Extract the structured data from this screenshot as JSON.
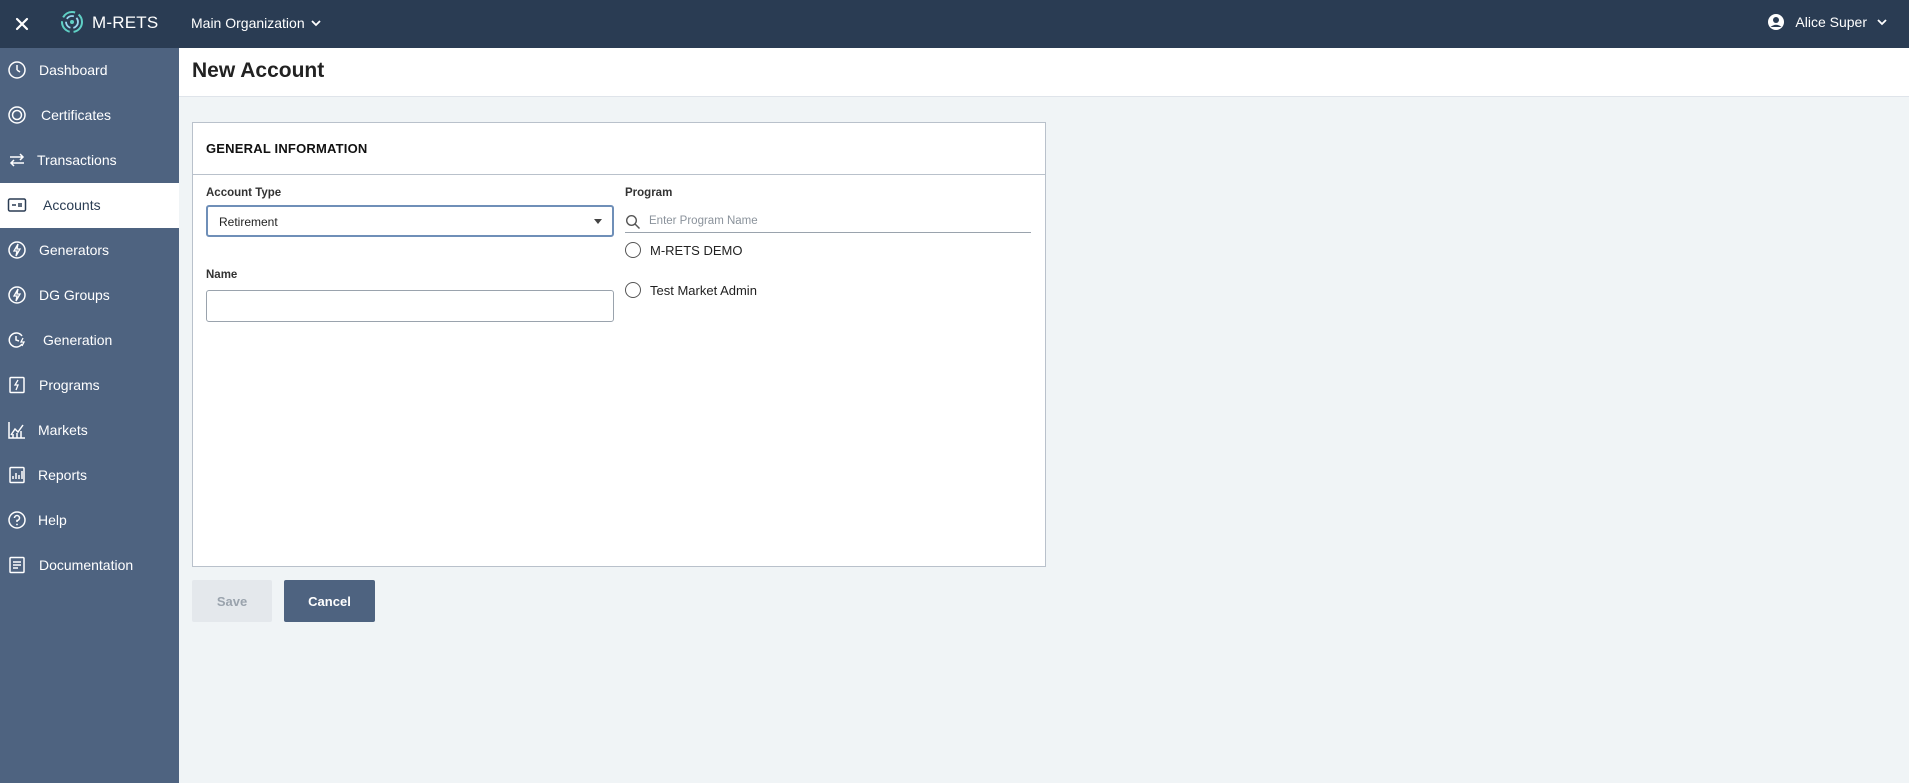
{
  "topbar": {
    "brand": "M-RETS",
    "organization": "Main Organization",
    "user": "Alice Super"
  },
  "sidebar": {
    "items": [
      {
        "label": "Dashboard",
        "icon": "dashboard-icon"
      },
      {
        "label": "Certificates",
        "icon": "certificate-icon"
      },
      {
        "label": "Transactions",
        "icon": "transfer-icon"
      },
      {
        "label": "Accounts",
        "icon": "account-icon",
        "active": true
      },
      {
        "label": "Generators",
        "icon": "generator-icon"
      },
      {
        "label": "DG Groups",
        "icon": "dg-groups-icon"
      },
      {
        "label": "Generation",
        "icon": "generation-icon"
      },
      {
        "label": "Programs",
        "icon": "programs-icon"
      },
      {
        "label": "Markets",
        "icon": "markets-icon"
      },
      {
        "label": "Reports",
        "icon": "reports-icon"
      },
      {
        "label": "Help",
        "icon": "help-icon"
      },
      {
        "label": "Documentation",
        "icon": "documentation-icon"
      }
    ]
  },
  "page": {
    "title": "New Account"
  },
  "form": {
    "section_title": "GENERAL INFORMATION",
    "account_type_label": "Account Type",
    "account_type_value": "Retirement",
    "name_label": "Name",
    "name_value": "",
    "program_label": "Program",
    "program_search_placeholder": "Enter Program Name",
    "program_options": [
      "M-RETS DEMO",
      "Test Market Admin"
    ]
  },
  "actions": {
    "save_label": "Save",
    "cancel_label": "Cancel"
  },
  "colors": {
    "topbar": "#2a3c53",
    "sidebar": "#4e6380",
    "background": "#f0f4f6",
    "primary_button": "#4e6380",
    "disabled_button": "#e4e8ec"
  }
}
